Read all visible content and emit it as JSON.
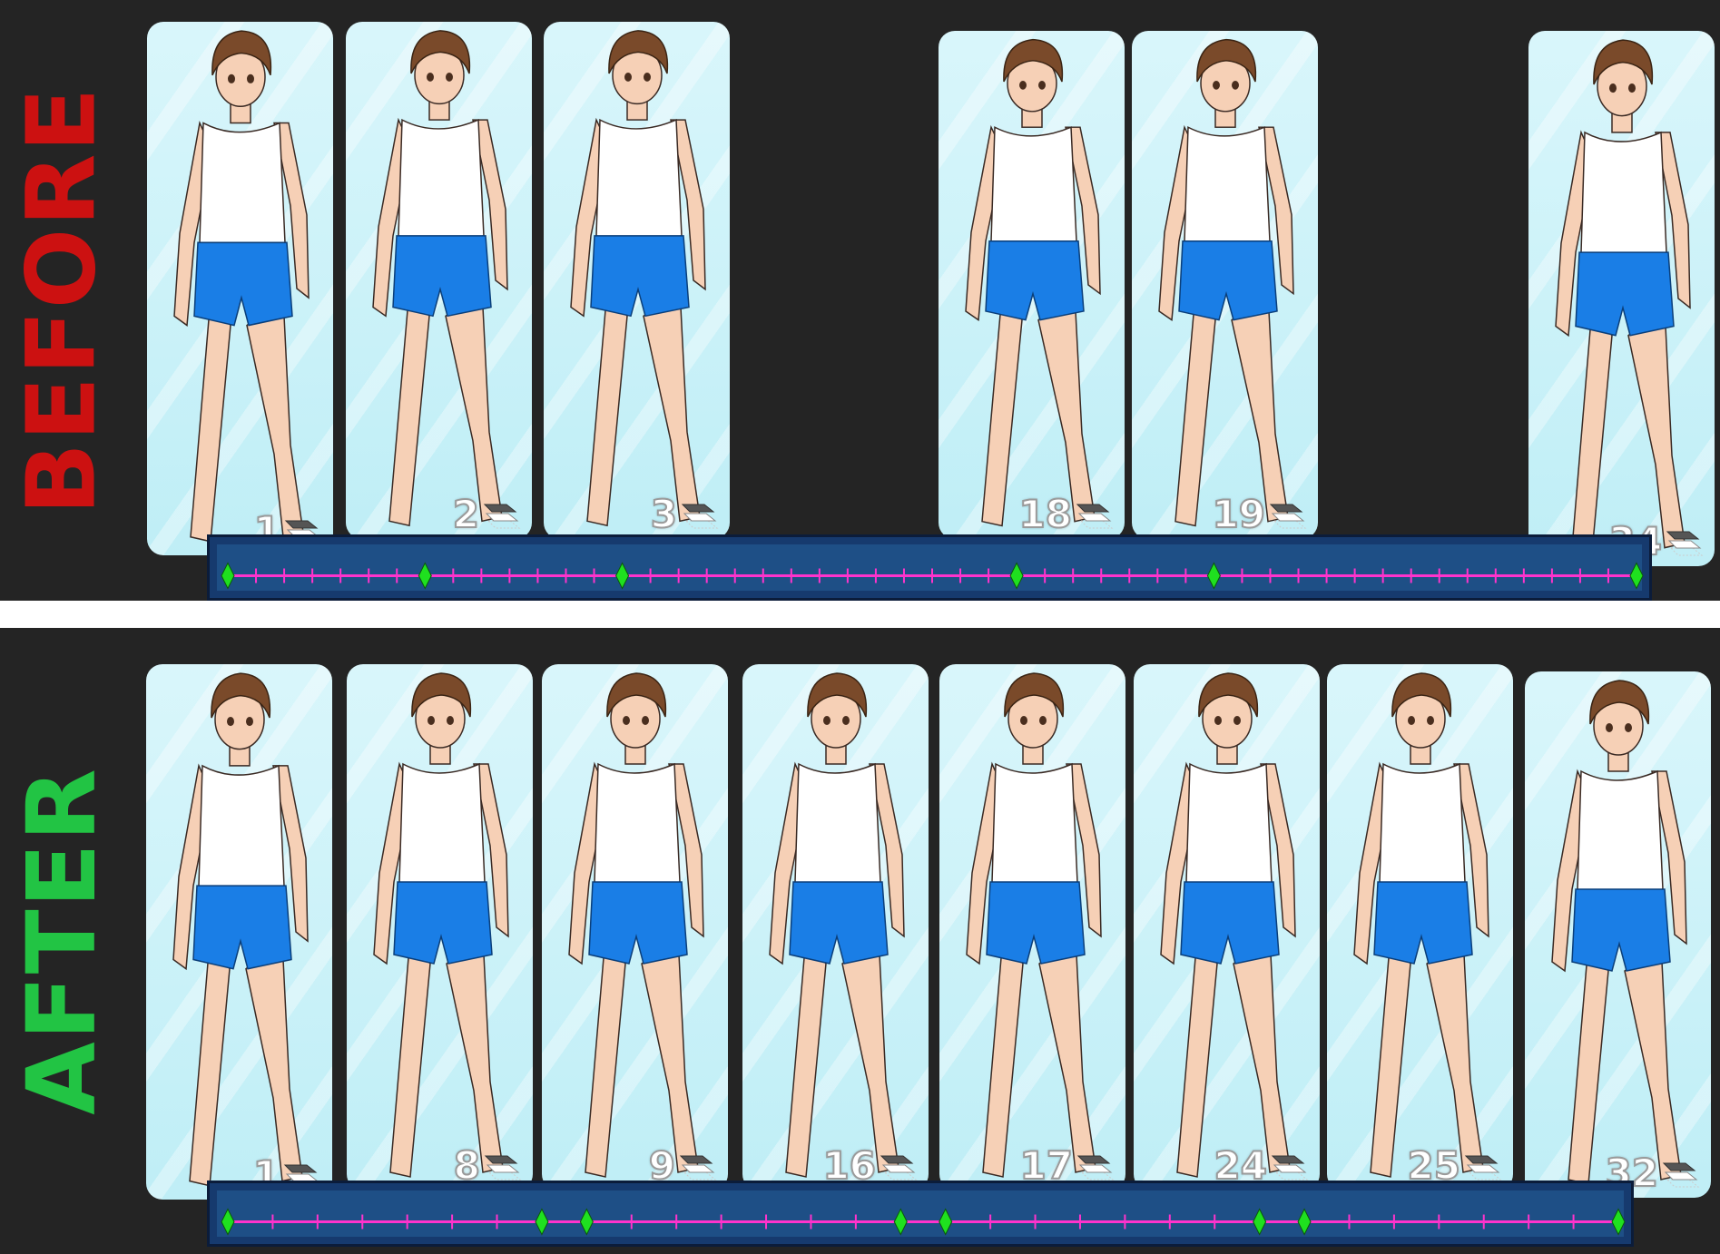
{
  "colors": {
    "background": "#242424",
    "separator": "#ffffff",
    "before_label": "#cc1111",
    "after_label": "#22c444",
    "timeline_bg": "#163a6e",
    "timeline_inner": "#1e4f86",
    "track": "#ff33cc",
    "keyframe": "#1fe01f",
    "frame_bg": "#c9f2f8"
  },
  "before": {
    "label": "BEFORE",
    "frames": [
      {
        "number": "1"
      },
      {
        "number": "2"
      },
      {
        "number": "3"
      },
      {
        "number": "18"
      },
      {
        "number": "19"
      },
      {
        "number": "34"
      }
    ],
    "timeline": {
      "total_frames": 34,
      "keyframes": [
        1,
        8,
        15,
        29,
        36,
        51
      ]
    }
  },
  "after": {
    "label": "AFTER",
    "frames": [
      {
        "number": "1"
      },
      {
        "number": "8"
      },
      {
        "number": "9"
      },
      {
        "number": "16"
      },
      {
        "number": "17"
      },
      {
        "number": "24"
      },
      {
        "number": "25"
      },
      {
        "number": "32"
      }
    ],
    "timeline": {
      "total_frames": 32,
      "keyframes": [
        1,
        8,
        9,
        16,
        17,
        24,
        25,
        32
      ]
    }
  },
  "icons": {
    "frame_layers": "layers-icon",
    "keyframe": "keyframe-diamond-icon"
  }
}
